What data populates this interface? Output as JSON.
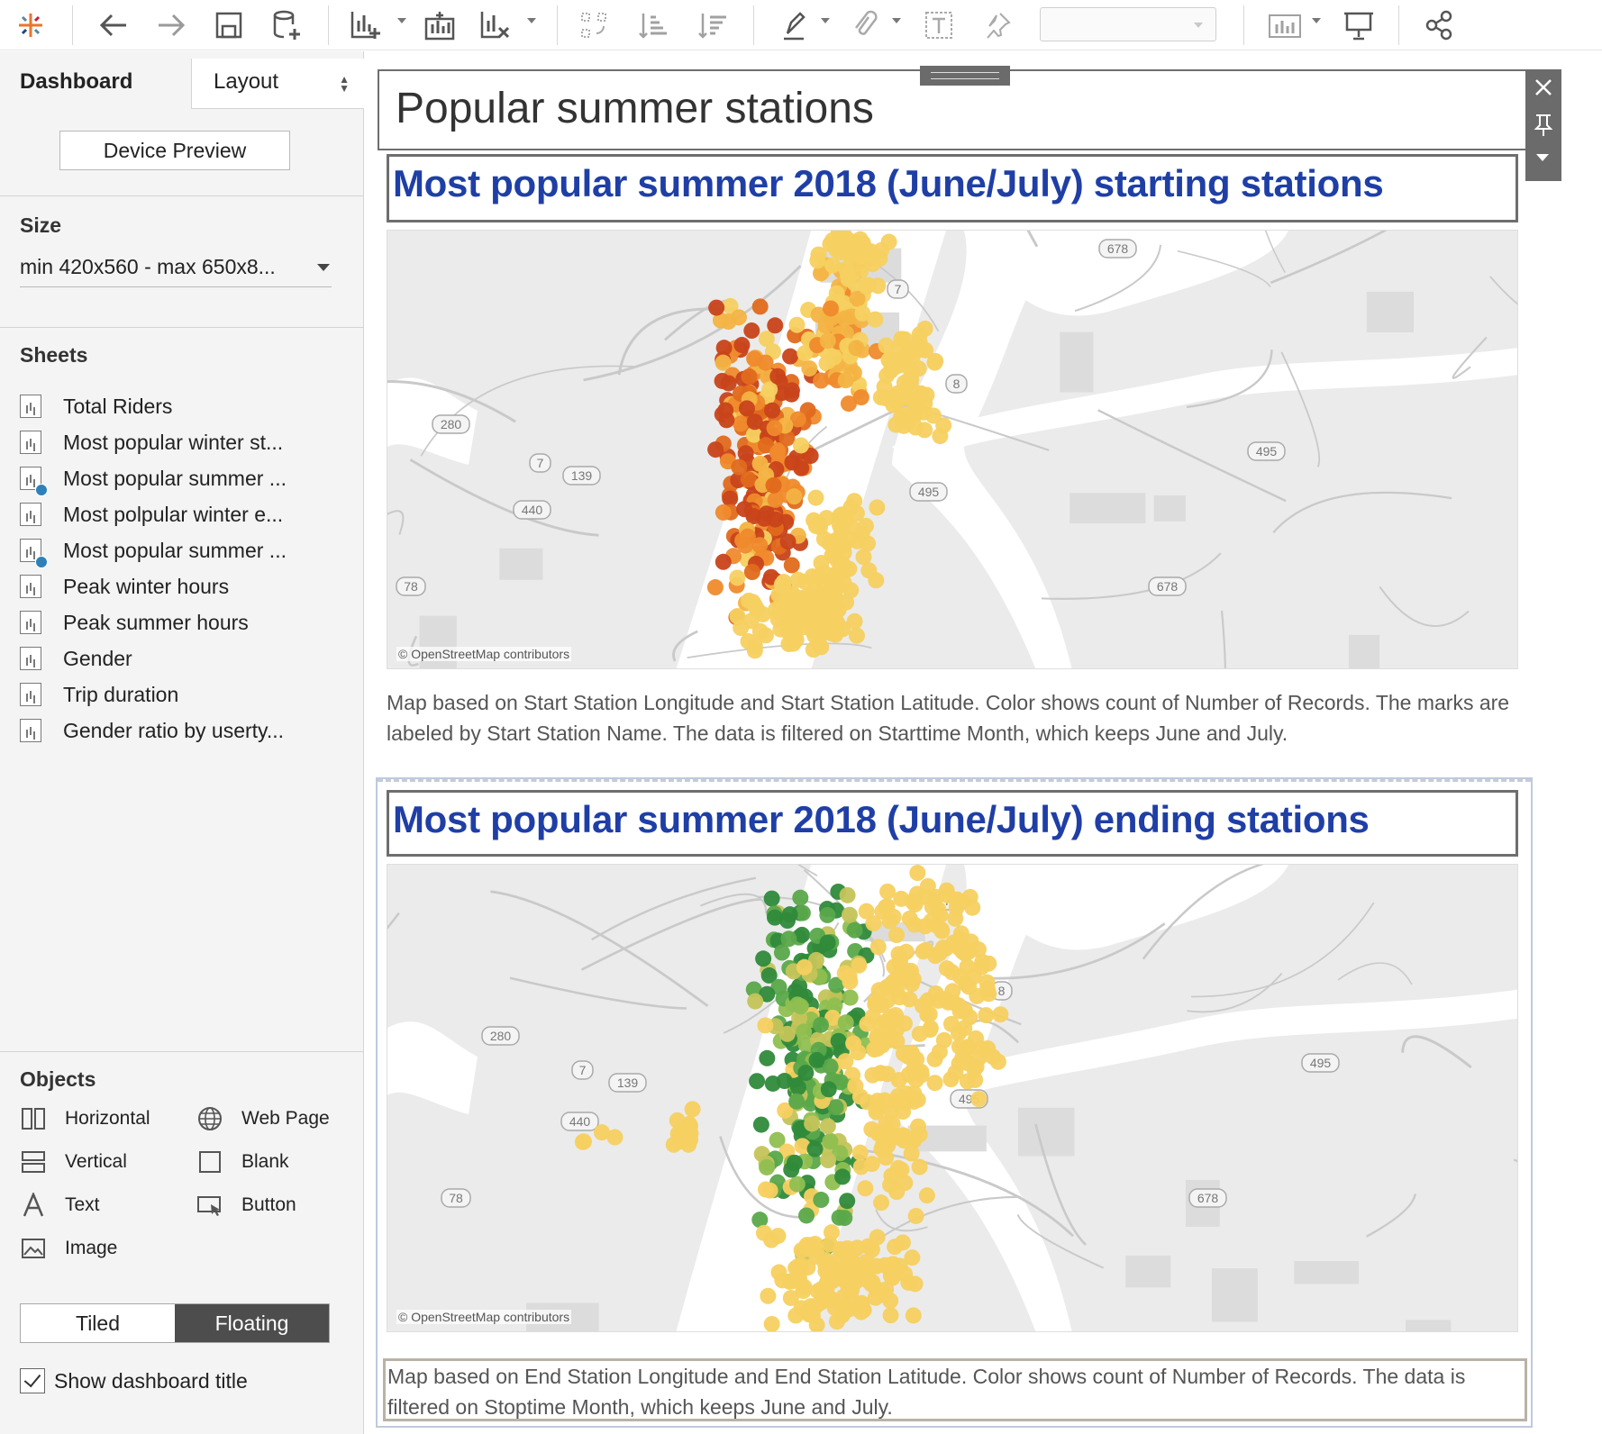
{
  "toolbar": {
    "icons": [
      "tableau-logo-icon",
      "undo-icon",
      "redo-icon",
      "save-icon",
      "new-data-source-icon",
      "new-worksheet-icon",
      "new-dashboard-icon",
      "clear-sheet-icon",
      "swap-rows-columns-icon",
      "sort-ascending-icon",
      "sort-descending-icon",
      "highlight-icon",
      "group-icon",
      "show-labels-icon",
      "pin-icon",
      "fit-dropdown",
      "show-me-icon",
      "presentation-mode-icon",
      "share-icon"
    ],
    "fit_value": ""
  },
  "sidebar": {
    "tabs": {
      "dashboard": "Dashboard",
      "layout": "Layout"
    },
    "device_preview": "Device Preview",
    "size": {
      "title": "Size",
      "value": "min 420x560 - max 650x8..."
    },
    "sheets": {
      "title": "Sheets",
      "items": [
        {
          "label": "Total Riders",
          "in_use": false
        },
        {
          "label": "Most popular winter st...",
          "in_use": false
        },
        {
          "label": "Most popular summer ...",
          "in_use": true
        },
        {
          "label": "Most polpular winter e...",
          "in_use": false
        },
        {
          "label": "Most popular summer ...",
          "in_use": true
        },
        {
          "label": "Peak winter hours",
          "in_use": false
        },
        {
          "label": "Peak summer hours",
          "in_use": false
        },
        {
          "label": "Gender",
          "in_use": false
        },
        {
          "label": "Trip duration",
          "in_use": false
        },
        {
          "label": "Gender ratio by userty...",
          "in_use": false
        }
      ]
    },
    "objects": {
      "title": "Objects",
      "items": [
        {
          "label": "Horizontal",
          "icon": "horizontal-container-icon"
        },
        {
          "label": "Web Page",
          "icon": "globe-icon"
        },
        {
          "label": "Vertical",
          "icon": "vertical-container-icon"
        },
        {
          "label": "Blank",
          "icon": "blank-icon"
        },
        {
          "label": "Text",
          "icon": "text-icon"
        },
        {
          "label": "Button",
          "icon": "button-icon"
        },
        {
          "label": "Image",
          "icon": "image-icon"
        }
      ]
    },
    "mode": {
      "tiled": "Tiled",
      "floating": "Floating",
      "selected": "Floating"
    },
    "show_title": {
      "label": "Show dashboard title",
      "checked": true
    }
  },
  "dashboard": {
    "title": "Popular summer stations",
    "start_sheet": {
      "title": "Most popular summer 2018 (June/July) starting stations",
      "attribution": "© OpenStreetMap contributors",
      "caption": "Map based on Start Station Longitude and Start Station Latitude.  Color shows count of Number of Records. The marks are labeled by Start Station Name. The data is filtered on Starttime Month, which keeps June and July.",
      "palette": [
        "#f5d060",
        "#f3b445",
        "#ef8a2c",
        "#e06a1c",
        "#c8431a"
      ]
    },
    "end_sheet": {
      "title": "Most popular summer 2018 (June/July) ending stations",
      "attribution": "© OpenStreetMap contributors",
      "caption": "Map based on End Station Longitude and End Station Latitude.  Color shows count of Number of Records. The data is filtered on Stoptime Month, which keeps June and July.",
      "palette": [
        "#f5d060",
        "#c4c45a",
        "#8fbf50",
        "#5aa84a",
        "#2f8a3a"
      ]
    },
    "map_labels": {
      "start": [
        "678",
        "7",
        "8",
        "280",
        "7",
        "139",
        "440",
        "495",
        "495",
        "78",
        "678"
      ],
      "end": [
        "7",
        "8",
        "280",
        "7",
        "139",
        "440",
        "495",
        "495",
        "78",
        "678"
      ]
    }
  }
}
